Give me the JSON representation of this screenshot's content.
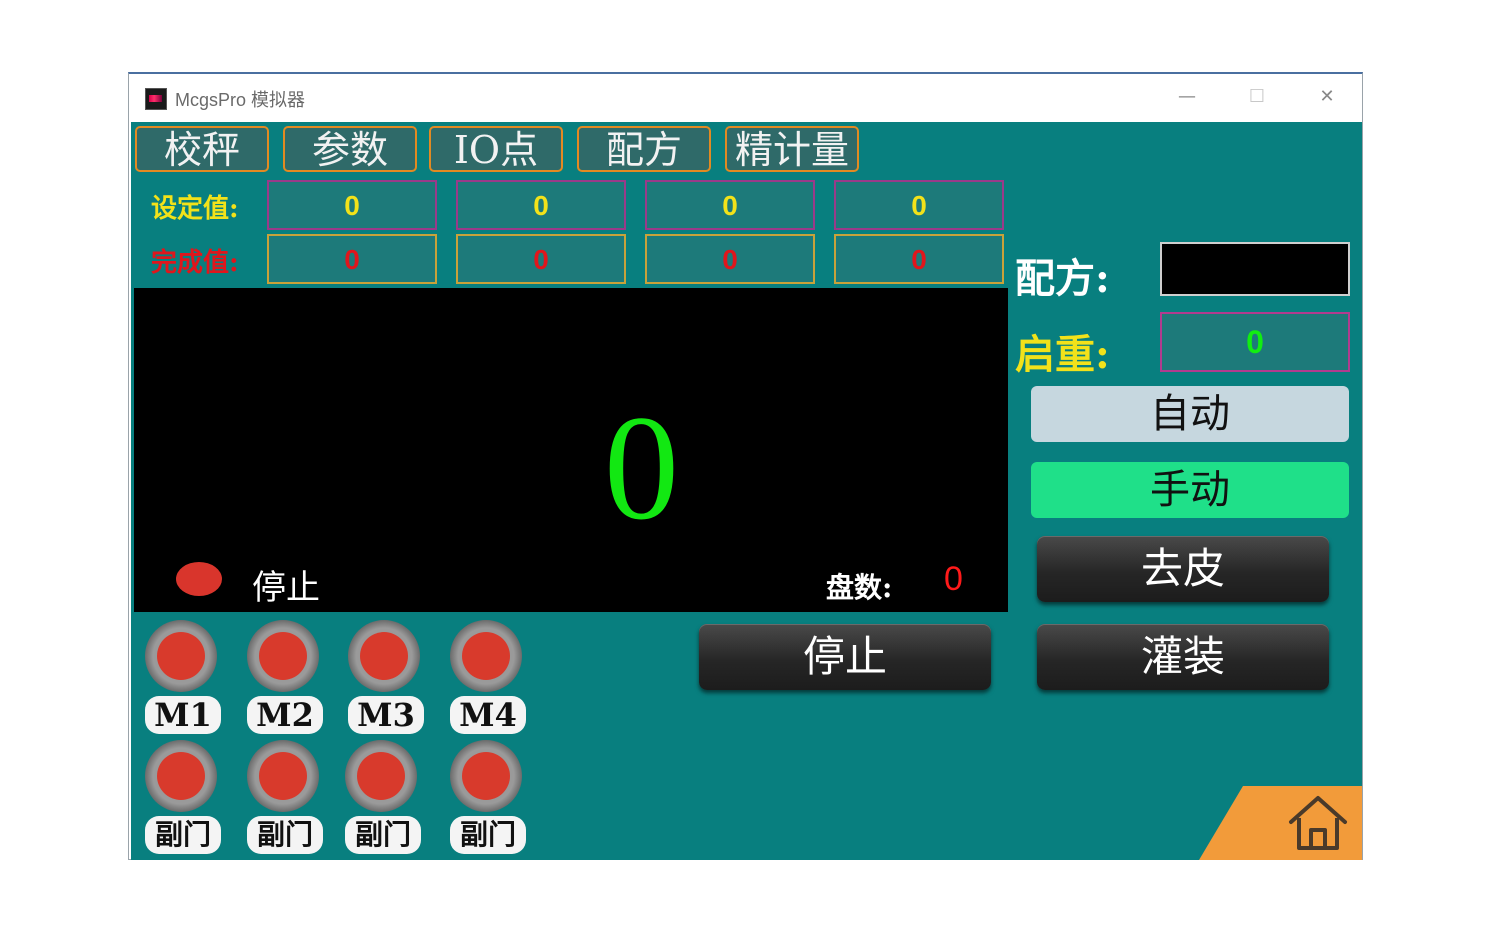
{
  "window": {
    "title": "McgsPro 模拟器",
    "minimize": "—",
    "maximize": "☐",
    "close": "✕"
  },
  "tabs": [
    "校秤",
    "参数",
    "IO点",
    "配方",
    "精计量"
  ],
  "setpoint_row": {
    "label": "设定值:",
    "values": [
      "0",
      "0",
      "0",
      "0"
    ]
  },
  "complete_row": {
    "label": "完成值:",
    "values": [
      "0",
      "0",
      "0",
      "0"
    ]
  },
  "display": {
    "weight": "0",
    "status_text": "停止",
    "pan_label": "盘数:",
    "pan_count": "0"
  },
  "right_panel": {
    "recipe_label": "配方:",
    "recipe_value": "",
    "start_weight_label": "启重:",
    "start_weight_value": "0",
    "auto_button": "自动",
    "manual_button": "手动",
    "tare_button": "去皮",
    "fill_button": "灌装",
    "stop_button": "停止"
  },
  "motors": [
    "M1",
    "M2",
    "M3",
    "M4"
  ],
  "sub_doors": [
    "副门",
    "副门",
    "副门",
    "副门"
  ],
  "colors": {
    "screen_bg": "#087f7f",
    "tab_border": "#e28a22",
    "lamp_red": "#d83a2c",
    "weight_green": "#12e812",
    "home": "#f29b3a"
  },
  "icons": {
    "home": "home-icon"
  }
}
